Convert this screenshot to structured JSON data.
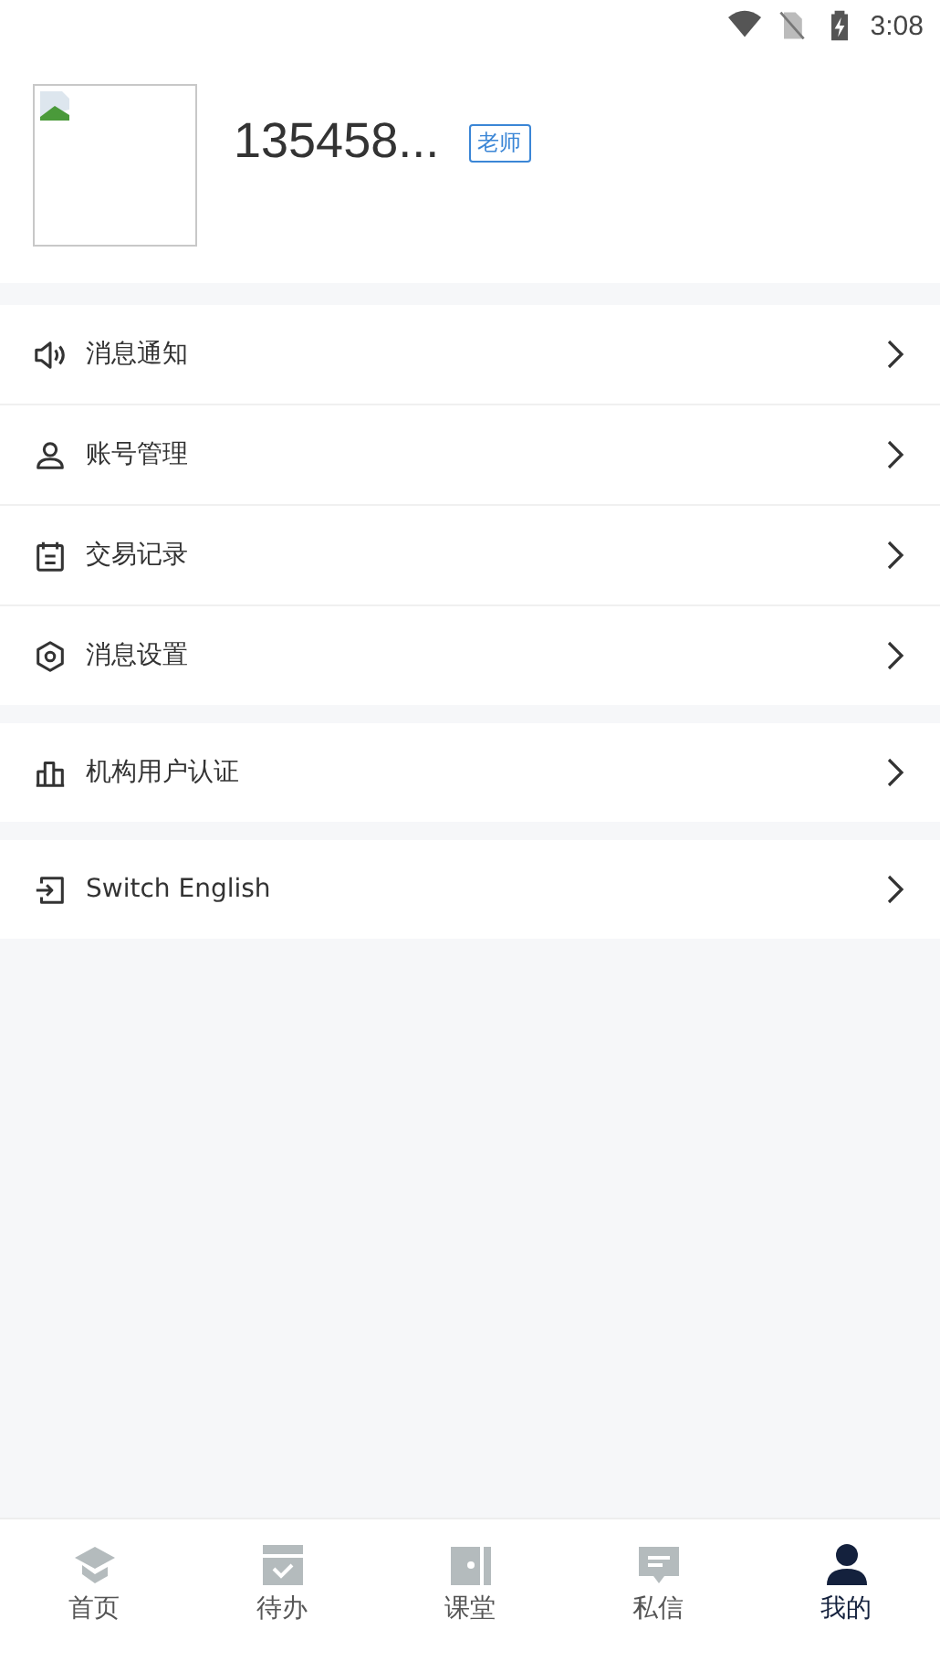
{
  "status_bar": {
    "time": "3:08"
  },
  "profile": {
    "name": "135458...",
    "role_badge": "老师"
  },
  "menu_groups": [
    {
      "items": [
        {
          "kind": "speaker",
          "label": "消息通知"
        },
        {
          "kind": "person",
          "label": "账号管理"
        },
        {
          "kind": "calendar",
          "label": "交易记录"
        },
        {
          "kind": "hexagon",
          "label": "消息设置"
        }
      ]
    },
    {
      "items": [
        {
          "kind": "chart",
          "label": "机构用户认证"
        }
      ]
    },
    {
      "items": [
        {
          "kind": "enter",
          "label": "Switch English"
        }
      ]
    }
  ],
  "tab_bar": [
    {
      "kind": "home",
      "label": "首页",
      "selected": false
    },
    {
      "kind": "todo",
      "label": "待办",
      "selected": false
    },
    {
      "kind": "class",
      "label": "课堂",
      "selected": false
    },
    {
      "kind": "message",
      "label": "私信",
      "selected": false
    },
    {
      "kind": "me",
      "label": "我的",
      "selected": true
    }
  ]
}
